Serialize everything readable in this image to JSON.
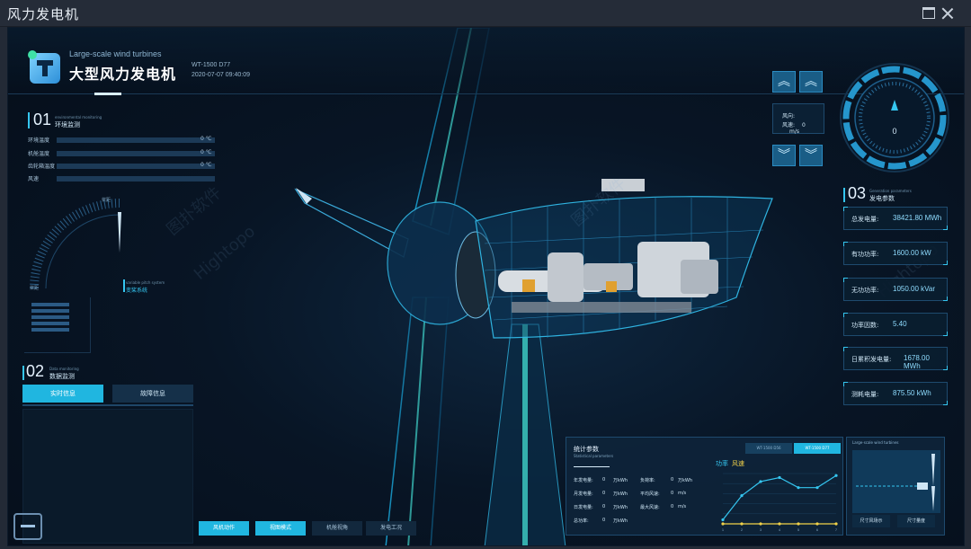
{
  "window": {
    "title": "风力发电机"
  },
  "header": {
    "en_title": "Large-scale wind turbines",
    "cn_title": "大型风力发电机",
    "model": "WT-1500 D77",
    "timestamp": "2020-07-07 09:40:09"
  },
  "env": {
    "num": "01",
    "en": "environmental monitoring",
    "title": "环境监测",
    "rows": [
      {
        "label": "环境温度",
        "value": "0 ℃"
      },
      {
        "label": "机舱温度",
        "value": "0 ℃"
      },
      {
        "label": "齿轮箱温度",
        "value": "0 ℃"
      },
      {
        "label": "风速",
        "value": ""
      }
    ]
  },
  "pitch": {
    "top_label": "桨距",
    "bottom_label": "桨距",
    "en": "variable pitch system",
    "title": "变桨系统"
  },
  "data_monitor": {
    "num": "02",
    "en": "Data monitoring",
    "title": "数据监测",
    "tabs": [
      "实时信息",
      "故障信息"
    ]
  },
  "bottom_buttons": [
    "风机动作",
    "视图模式",
    "机舱视角",
    "发电工况"
  ],
  "controls": {
    "up_icon": "chevron-double-up",
    "down_icon": "chevron-double-down",
    "wind_dir_label": "风向:",
    "wind_speed_label": "风速:",
    "wind_speed_value": "0",
    "wind_speed_unit": "m/s"
  },
  "compass": {
    "value": "0"
  },
  "power": {
    "num": "03",
    "en": "Generation parameters",
    "title": "发电参数",
    "items": [
      {
        "key": "总发电量:",
        "value": "38421.80 MWh"
      },
      {
        "key": "有功功率:",
        "value": "1600.00 kW"
      },
      {
        "key": "无功功率:",
        "value": "1050.00 kVar"
      },
      {
        "key": "功率因数:",
        "value": "5.40"
      },
      {
        "key": "日累积发电量:",
        "value": "1678.00 MWh"
      },
      {
        "key": "测耗电量:",
        "value": "875.50 kWh"
      }
    ]
  },
  "stats": {
    "title": "统计参数",
    "en": "Statistical parameters",
    "tabs": [
      "WT-1500 D56",
      "WT-1500 D77"
    ],
    "legend_power": "功率",
    "legend_wind": "风速",
    "cells": [
      [
        "年发电量:",
        "0",
        "万kWh",
        "负荷率:",
        "0",
        "万kWh"
      ],
      [
        "月发电量:",
        "0",
        "万kWh",
        "平均风速:",
        "0",
        "m/s"
      ],
      [
        "日发电量:",
        "0",
        "万kWh",
        "最大风速:",
        "0",
        "m/s"
      ],
      [
        "总功率:",
        "0",
        "万kWh",
        "",
        "",
        ""
      ]
    ]
  },
  "chart_data": {
    "type": "line",
    "categories": [
      "1",
      "2",
      "3",
      "4",
      "5",
      "6",
      "7"
    ],
    "series": [
      {
        "name": "功率",
        "values": [
          2,
          14,
          21,
          23,
          18,
          18,
          24
        ],
        "color": "#35c6f0"
      },
      {
        "name": "风速",
        "values": [
          0,
          0,
          0,
          0,
          0,
          0,
          0
        ],
        "color": "#f2d24a"
      }
    ],
    "ylim": [
      0,
      25
    ]
  },
  "turbine_panel": {
    "en": "Large-scale wind turbines",
    "buttons": [
      "尺寸风场示",
      "尺寸量度"
    ]
  },
  "watermark": [
    "图扑软件",
    "Hightopo"
  ]
}
